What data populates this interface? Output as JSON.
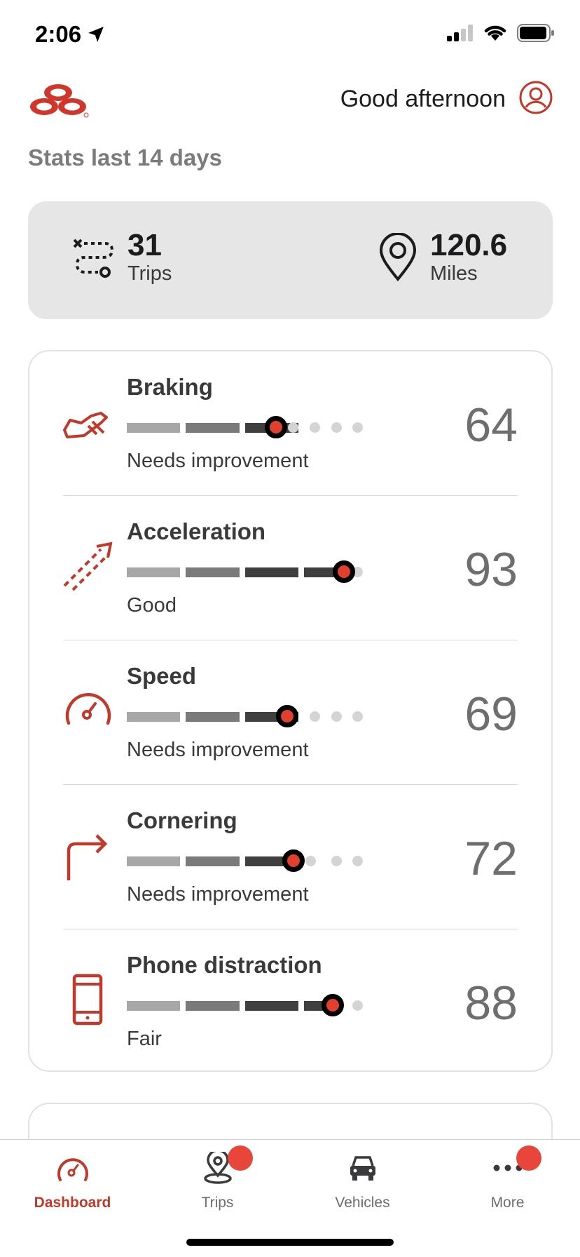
{
  "status_bar": {
    "time": "2:06"
  },
  "header": {
    "greeting": "Good afternoon"
  },
  "stats": {
    "title": "Stats last 14 days",
    "trips": {
      "value": "31",
      "label": "Trips"
    },
    "miles": {
      "value": "120.6",
      "label": "Miles"
    }
  },
  "metrics": [
    {
      "name": "Braking",
      "status": "Needs improvement",
      "score": "64",
      "level": 0.64,
      "icon": "braking-icon"
    },
    {
      "name": "Acceleration",
      "status": "Good",
      "score": "93",
      "level": 0.93,
      "icon": "acceleration-icon"
    },
    {
      "name": "Speed",
      "status": "Needs improvement",
      "score": "69",
      "level": 0.69,
      "icon": "speedometer-icon"
    },
    {
      "name": "Cornering",
      "status": "Needs improvement",
      "score": "72",
      "level": 0.72,
      "icon": "turn-right-icon"
    },
    {
      "name": "Phone distraction",
      "status": "Fair",
      "score": "88",
      "level": 0.88,
      "icon": "phone-icon"
    }
  ],
  "tabbar": {
    "items": [
      {
        "label": "Dashboard",
        "icon": "dashboard-icon",
        "active": true,
        "badge": false
      },
      {
        "label": "Trips",
        "icon": "trips-icon",
        "active": false,
        "badge": true
      },
      {
        "label": "Vehicles",
        "icon": "car-icon",
        "active": false,
        "badge": false
      },
      {
        "label": "More",
        "icon": "more-icon",
        "active": false,
        "badge": true
      }
    ]
  },
  "colors": {
    "accent": "#c0392b",
    "marker": "#e2402f",
    "badge": "#e8463a",
    "card_bg": "#e6e6e6"
  }
}
